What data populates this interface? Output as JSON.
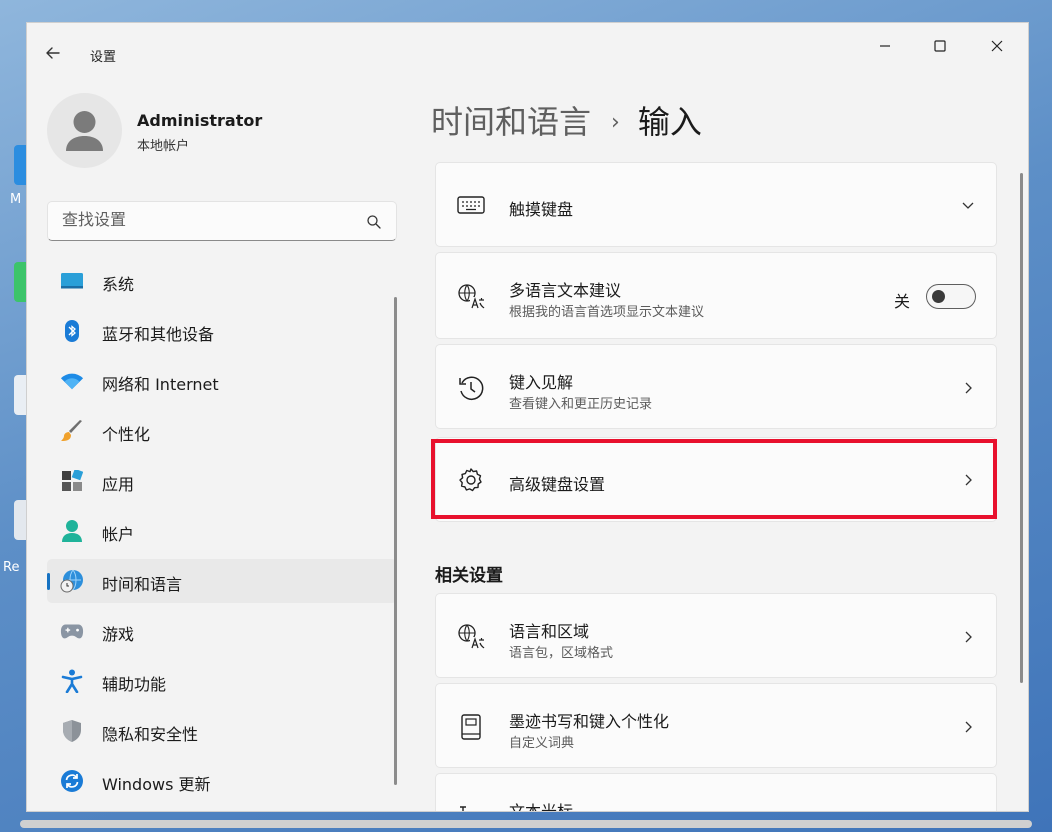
{
  "window": {
    "app_title": "设置"
  },
  "desktop": {
    "icon_labels": [
      "M",
      "Re"
    ]
  },
  "profile": {
    "name": "Administrator",
    "account_type": "本地帐户"
  },
  "search": {
    "placeholder": "查找设置"
  },
  "sidebar": {
    "items": [
      {
        "label": "系统",
        "icon": "system-icon"
      },
      {
        "label": "蓝牙和其他设备",
        "icon": "bluetooth-icon"
      },
      {
        "label": "网络和 Internet",
        "icon": "wifi-icon"
      },
      {
        "label": "个性化",
        "icon": "brush-icon"
      },
      {
        "label": "应用",
        "icon": "apps-icon"
      },
      {
        "label": "帐户",
        "icon": "account-icon"
      },
      {
        "label": "时间和语言",
        "icon": "globe-clock-icon",
        "active": true
      },
      {
        "label": "游戏",
        "icon": "gamepad-icon"
      },
      {
        "label": "辅助功能",
        "icon": "accessibility-icon"
      },
      {
        "label": "隐私和安全性",
        "icon": "shield-icon"
      },
      {
        "label": "Windows 更新",
        "icon": "update-icon"
      }
    ]
  },
  "breadcrumb": {
    "parent": "时间和语言",
    "separator": "›",
    "current": "输入"
  },
  "cards": [
    {
      "title": "触摸键盘",
      "icon": "keyboard-icon",
      "control": "chevron-down"
    },
    {
      "title": "多语言文本建议",
      "subtitle": "根据我的语言首选项显示文本建议",
      "icon": "language-icon",
      "control": "toggle",
      "toggle_label": "关",
      "toggle_on": false
    },
    {
      "title": "键入见解",
      "subtitle": "查看键入和更正历史记录",
      "icon": "history-icon",
      "control": "chevron-right"
    },
    {
      "title": "高级键盘设置",
      "icon": "gear-icon",
      "control": "chevron-right",
      "highlighted": true
    }
  ],
  "related": {
    "title": "相关设置",
    "cards": [
      {
        "title": "语言和区域",
        "subtitle": "语言包，区域格式",
        "icon": "language-icon"
      },
      {
        "title": "墨迹书写和键入个性化",
        "subtitle": "自定义词典",
        "icon": "notebook-icon"
      },
      {
        "title": "文本光标",
        "icon": "text-cursor-icon"
      }
    ]
  },
  "colors": {
    "accent": "#1672c2",
    "highlight_border": "#e8112d",
    "window_bg": "#f3f3f3",
    "card_bg": "#fbfbfb"
  }
}
